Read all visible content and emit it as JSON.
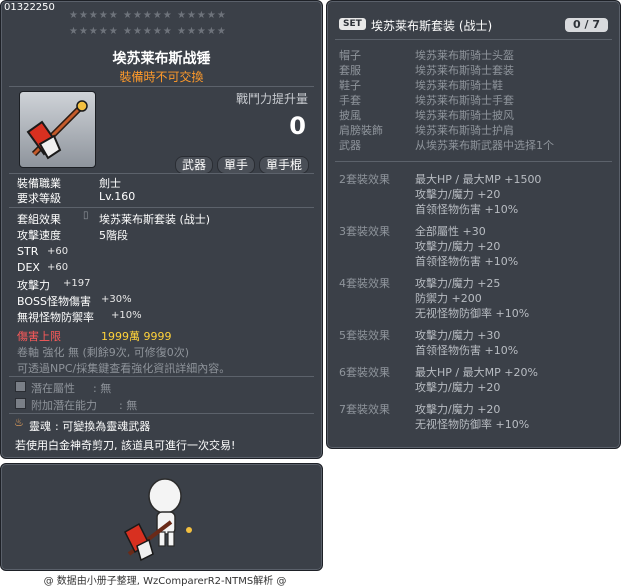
{
  "item": {
    "code": "01322250",
    "stars_row1": "★★★★★ ★★★★★ ★★★★★",
    "stars_row2": "★★★★★ ★★★★★ ★★★★★",
    "name": "埃苏莱布斯战锤",
    "trade_status": "裝備時不可交換",
    "combat_power_label": "戰鬥力提升量",
    "combat_power_value": "0",
    "tags": [
      "武器",
      "單手",
      "單手棍"
    ],
    "job_label": "裝備職業",
    "job_value": "劍士",
    "level_label": "要求等級",
    "level_value": "Lv.160",
    "set_effect_label": "套組效果",
    "set_effect_value": "埃苏莱布斯套装 (战士)",
    "attack_speed_label": "攻擊速度",
    "attack_speed_value": "5階段",
    "stats": [
      {
        "label": "STR",
        "value": "+60"
      },
      {
        "label": "DEX",
        "value": "+60"
      },
      {
        "label": "攻擊力",
        "value": "+197"
      },
      {
        "label": "BOSS怪物傷害",
        "value": "+30%"
      },
      {
        "label": "無視怪物防禦率",
        "value": "+10%"
      }
    ],
    "damage_cap_label": "傷害上限",
    "damage_cap_value": "1999萬 9999",
    "scroll_info": "卷軸 強化 無 (剩餘9次, 可修復0次)",
    "npc_info": "可透過NPC/採集鍵查看強化資訊詳細內容。",
    "potential_label": "潛在屬性",
    "potential_value": ": 無",
    "additional_potential_label": "附加潛在能力",
    "additional_potential_value": ": 無",
    "soul_label": "靈魂",
    "soul_value": ": 可變換為靈魂武器",
    "scissors_info": "若使用白金神奇剪刀, 該道具可進行一次交易!"
  },
  "set": {
    "badge": "SET",
    "name": "埃苏莱布斯套装 (战士)",
    "count": "0 / 7",
    "pieces": [
      {
        "slot": "帽子",
        "name": "埃苏莱布斯骑士头盔"
      },
      {
        "slot": "套服",
        "name": "埃苏莱布斯骑士套装"
      },
      {
        "slot": "鞋子",
        "name": "埃苏莱布斯骑士鞋"
      },
      {
        "slot": "手套",
        "name": "埃苏莱布斯骑士手套"
      },
      {
        "slot": "披風",
        "name": "埃苏莱布斯骑士披风"
      },
      {
        "slot": "肩膀裝飾",
        "name": "埃苏莱布斯骑士护肩"
      },
      {
        "slot": "武器",
        "name": "从埃苏莱布斯武器中选择1个"
      }
    ],
    "effects": [
      {
        "label": "2套裝效果",
        "lines": [
          "最大HP / 最大MP  +1500",
          "攻擊力/魔力 +20",
          "首领怪物伤害 +10%"
        ]
      },
      {
        "label": "3套裝效果",
        "lines": [
          "全部屬性 +30",
          "攻擊力/魔力 +20",
          "首领怪物伤害 +10%"
        ]
      },
      {
        "label": "4套裝效果",
        "lines": [
          "攻擊力/魔力 +25",
          "防禦力  +200",
          "无视怪物防御率 +10%"
        ]
      },
      {
        "label": "5套裝效果",
        "lines": [
          "攻擊力/魔力 +30",
          "首领怪物伤害 +10%"
        ]
      },
      {
        "label": "6套裝效果",
        "lines": [
          "最大HP / 最大MP  +20%",
          "攻擊力/魔力 +20"
        ]
      },
      {
        "label": "7套裝效果",
        "lines": [
          "攻擊力/魔力 +20",
          "无视怪物防御率 +10%"
        ]
      }
    ]
  },
  "footer": "@ 数据由小册子整理, WzComparerR2-NTMS解析 @",
  "colors": {
    "panel": "#3b4048",
    "title": "#ffffff",
    "trade": "#ff9a2a",
    "damage_cap": "#ffd23a",
    "set_text": "#8f959c"
  },
  "icons": [
    "hammer-weapon-icon",
    "lock-icon",
    "potential-icon",
    "additional-potential-icon",
    "soul-flame-icon",
    "character-preview"
  ]
}
